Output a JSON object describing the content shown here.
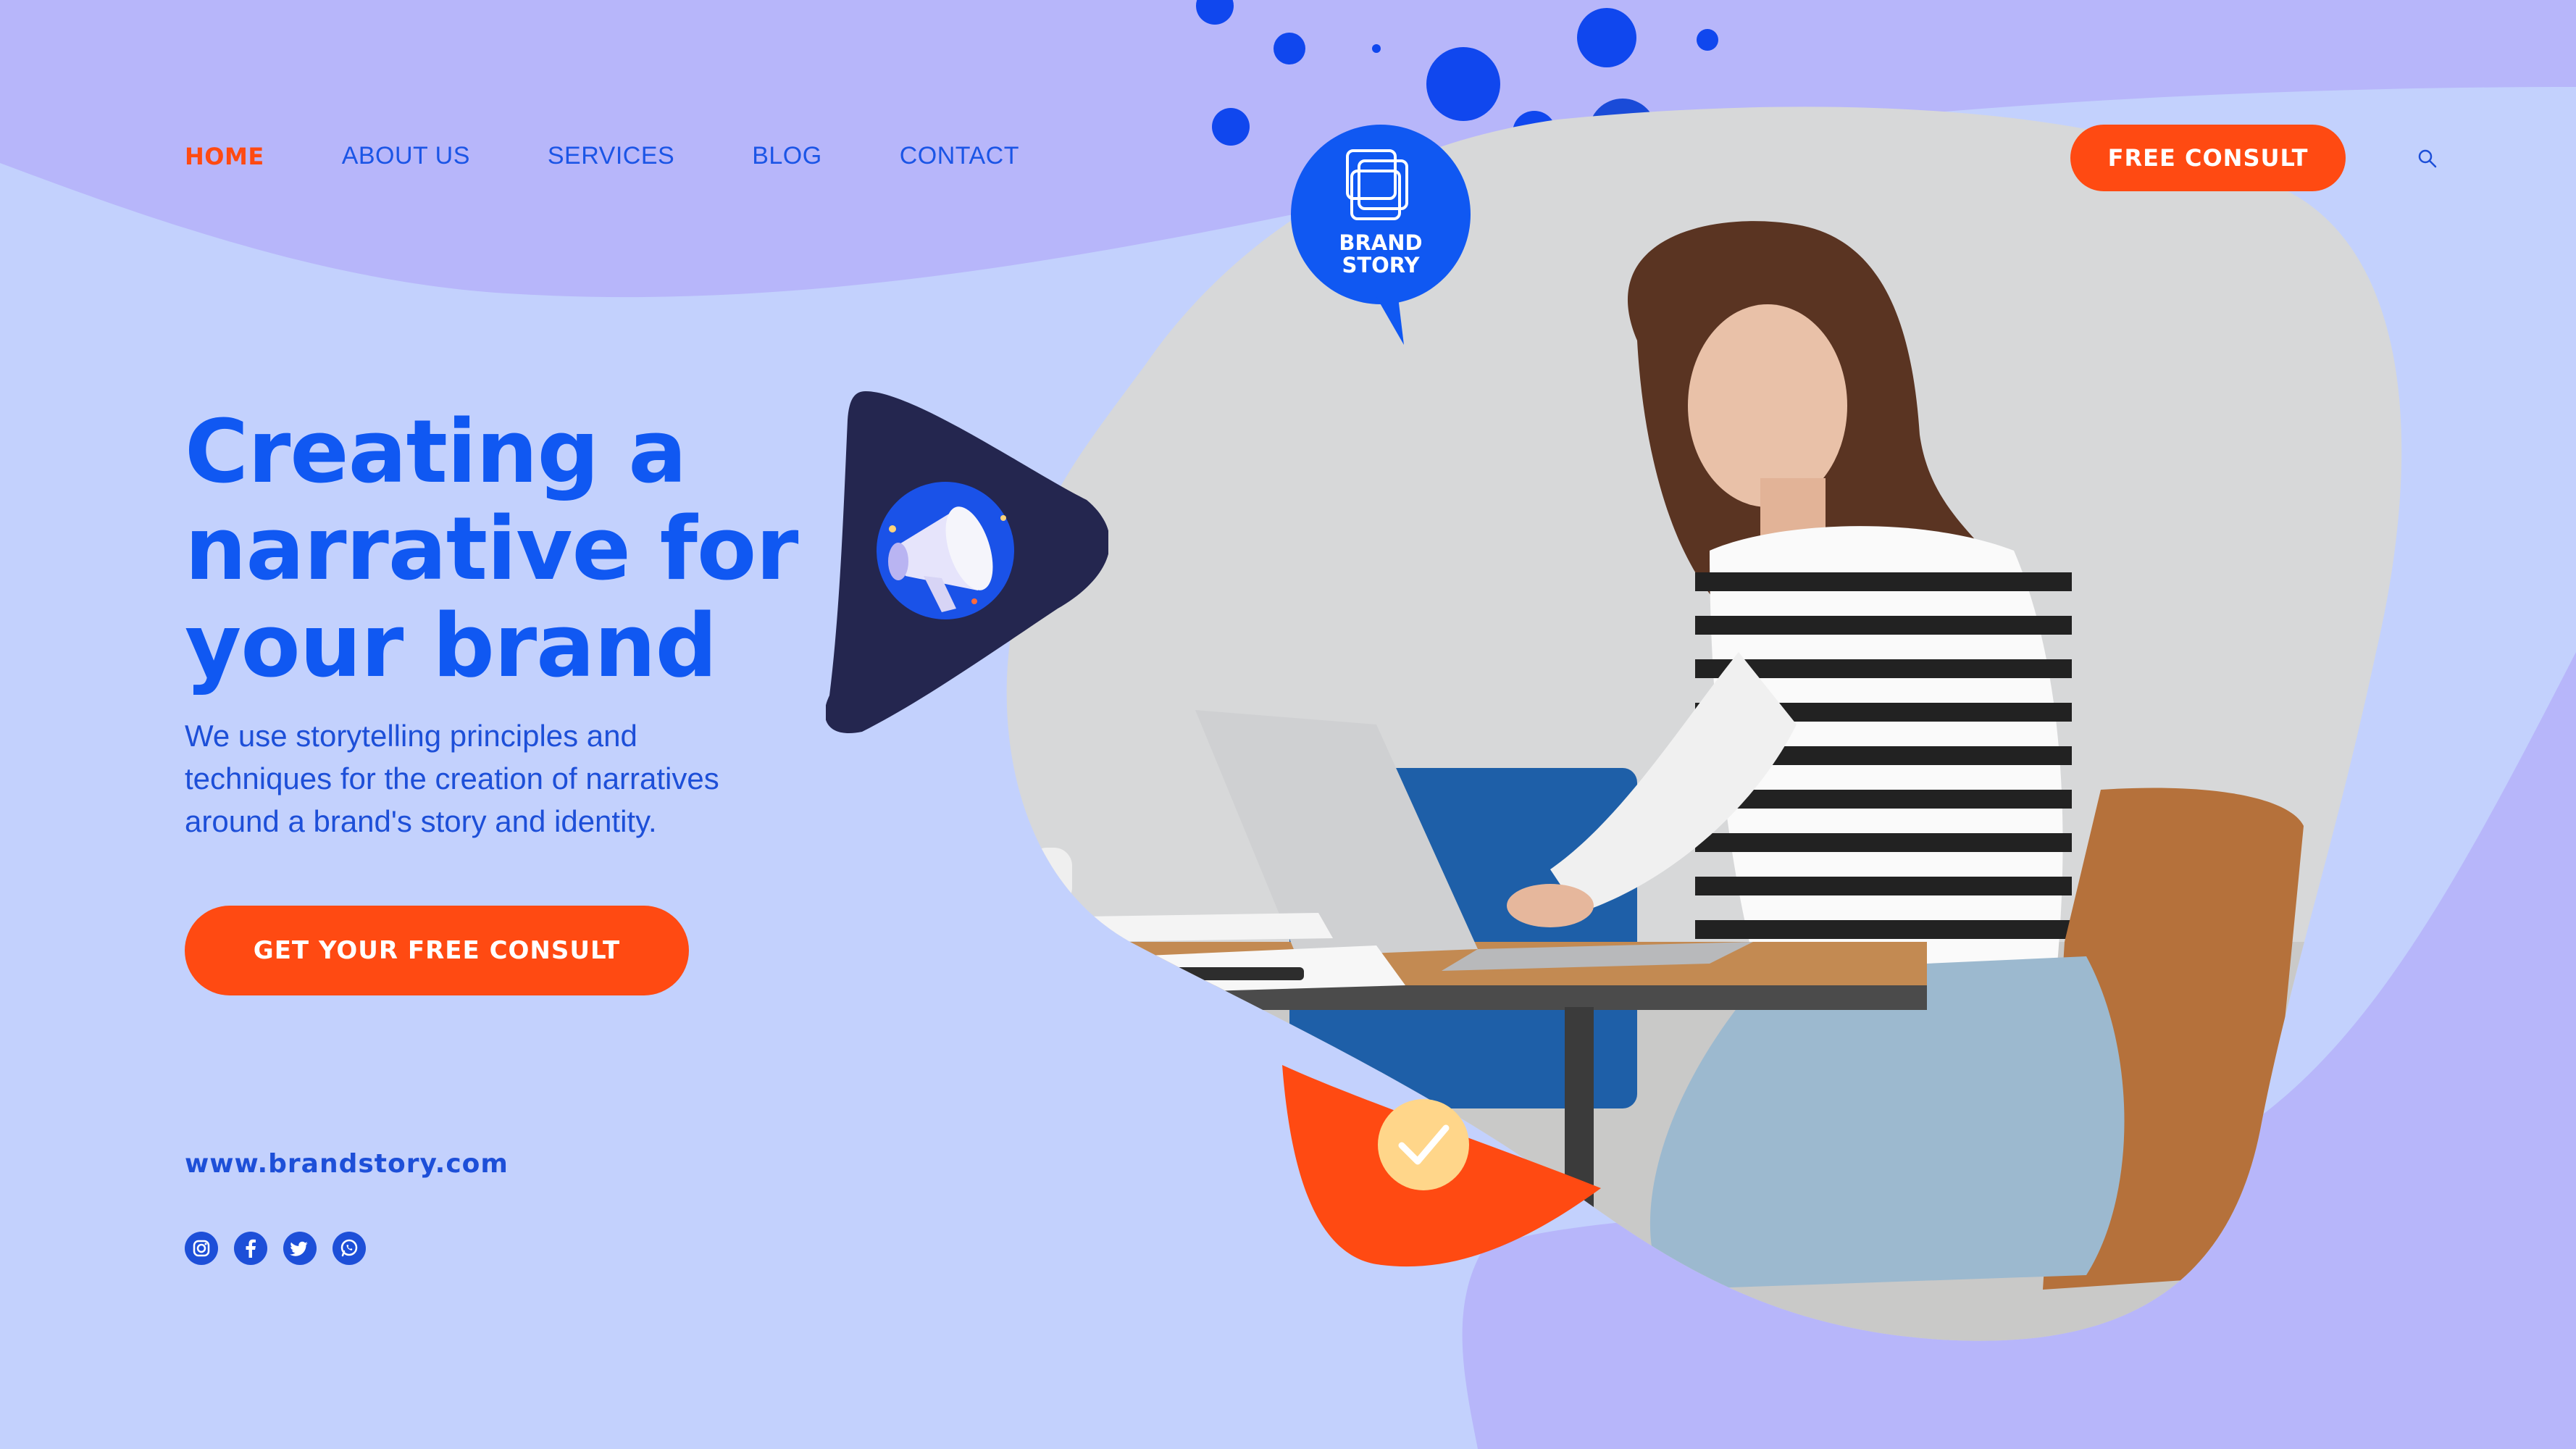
{
  "colors": {
    "page_background": "#c3d1fd",
    "top_wave": "#b7b6fa",
    "accent_orange": "#ff4a12",
    "accent_blue": "#1058f2",
    "navy": "#24264f"
  },
  "nav": {
    "items": [
      {
        "label": "HOME",
        "active": true
      },
      {
        "label": "ABOUT US",
        "active": false
      },
      {
        "label": "SERVICES",
        "active": false
      },
      {
        "label": "BLOG",
        "active": false
      },
      {
        "label": "CONTACT",
        "active": false
      }
    ],
    "cta_label": "FREE CONSULT",
    "search_icon": "search-icon"
  },
  "logo": {
    "line1": "BRAND",
    "line2": "STORY"
  },
  "hero": {
    "title_line1": "Creating a",
    "title_line2": "narrative for",
    "title_line3": "your brand",
    "description_line1": "We use storytelling principles and",
    "description_line2": "techniques for the creation of narratives",
    "description_line3": "around a brand's story and identity.",
    "cta_label": "GET YOUR FREE CONSULT"
  },
  "footer": {
    "website": "www.brandstory.com",
    "socials": [
      "instagram-icon",
      "facebook-icon",
      "twitter-icon",
      "whatsapp-icon"
    ]
  }
}
